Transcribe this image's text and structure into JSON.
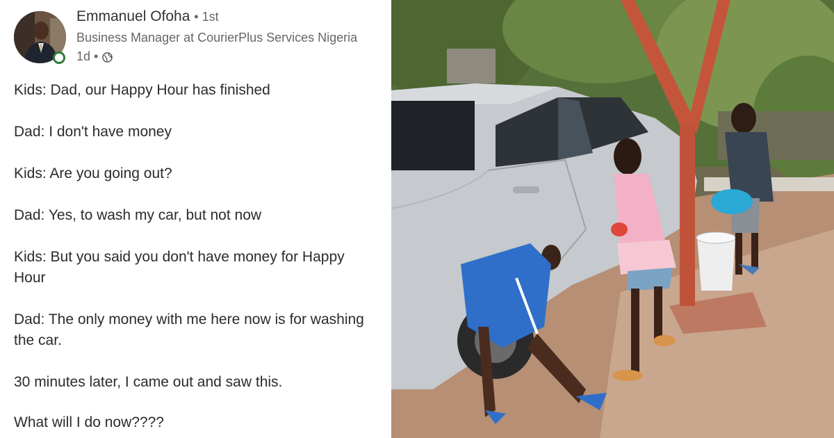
{
  "post": {
    "author": {
      "name": "Emmanuel Ofoha",
      "degree": "• 1st",
      "headline": "Business Manager at CourierPlus Services Nigeria",
      "time": "1d •",
      "visibility_icon": "globe-icon",
      "online_color": "#2e7d32"
    },
    "lines": [
      "Kids: Dad, our Happy Hour has finished",
      "Dad: I don't have money",
      "Kids: Are you going out?",
      "Dad: Yes, to wash my car, but not now",
      "Kids: But you said you don't have money for Happy",
      "Hour",
      "Dad: The only money with me here now is for washing",
      "the car.",
      "30 minutes later, I came out and saw this.",
      "What will I do now????"
    ]
  },
  "photo": {
    "subject": "children washing a silver car",
    "colors": {
      "car": "#c9ccd0",
      "ground": "#b98f74",
      "post": "#c8553a",
      "foliage": "#5f7a3e"
    }
  }
}
